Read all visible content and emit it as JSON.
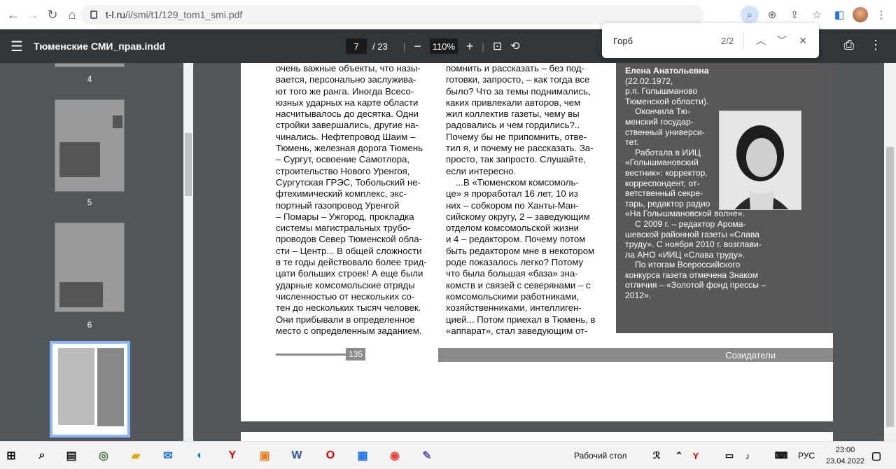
{
  "browser": {
    "url_host": "t-l.ru",
    "url_path": "/i/smi/t1/129_tom1_smi.pdf"
  },
  "pdf_toolbar": {
    "title": "Тюменские СМИ_прав.indd",
    "current_page": "7",
    "total_pages": "/ 23",
    "zoom": "110%"
  },
  "find": {
    "query": "Горб",
    "count": "2/2"
  },
  "thumbnails": [
    {
      "label": "4"
    },
    {
      "label": "5"
    },
    {
      "label": "6"
    }
  ],
  "article": {
    "col1": [
      "очень важные объекты, что назы-",
      "вается, персонально заслужива-",
      "ют того же ранга. Иногда Всесо-",
      "юзных ударных на карте области",
      "насчитывалось до десятка. Одни",
      "стройки завершались, другие на-",
      "чинались. Нефтепровод Шаим –",
      "Тюмень, железная дорога Тюмень",
      "– Сургут, освоение Самотлора,",
      "строительство Нового Уренгоя,",
      "Сургутская ГРЭС, Тобольский не-",
      "фтехимический комплекс, экс-",
      "портный газопровод Уренгой",
      "– Помары – Ужгород, прокладка",
      "системы магистральных трубо-",
      "проводов Север Тюменской обла-",
      "сти – Центр... В общей сложности",
      "в те годы действовало более трид-",
      "цати больших строек! А еще были",
      "ударные комсомольские отряды",
      "численностью от нескольких со-",
      "тен до нескольких тысяч человек.",
      "Они прибывали в определенное",
      "место с определенным заданием."
    ],
    "col2": [
      "помнить и рассказать – без под-",
      "готовки, запросто, – как тогда все",
      "было? Что за темы поднимались,",
      "каких привлекали авторов, чем",
      "жил коллектив газеты, чему вы",
      "радовались и чем гордились?..",
      "Почему бы не припомнить, отве-",
      "тил я, и почему не рассказать. За-",
      "просто, так запросто. Слушайте,",
      "если интересно.",
      "...В «Тюменском комсомоль-",
      "це» я проработал 16 лет, 10 из",
      "них – собкором по Ханты-Ман-",
      "сийскому округу, 2 – заведующим",
      "отделом комсомольской жизни",
      "и 4 – редактором. Почему потом",
      "быть редактором мне в некотором",
      "роде показалось легко? Потому",
      "что была большая «база» зна-",
      "комств и связей с северянами – с",
      "комсомольскими работниками,",
      "хозяйственниками, интеллиген-",
      "цией... Потом приехал в Тюмень, в",
      "«аппарат», стал заведующим от-"
    ],
    "bio": [
      "Елена Анатольевна",
      "(22.02.1972,",
      "р.п. Голышманово",
      "Тюменской области).",
      "Окончила Тю-",
      "менский государ-",
      "ственный универси-",
      "тет.",
      "Работала в ИИЦ",
      "«Голышмановский",
      "вестник»: корректор,",
      "корреспондент, от-",
      "ветственный секре-",
      "тарь, редактор радио",
      "«На Голышмановской волне».",
      "С 2009 г. – редактор Арома-",
      "шевской районной газеты «Слава",
      "труду». С ноября 2010 г. возглави-",
      "ла АНО «ИИЦ «Слава труду».",
      "По итогам Всероссийского",
      "конкурса газета отмечена Знаком",
      "отличия – «Золотой фонд прессы –",
      "2012»."
    ],
    "page_number": "135",
    "section": "Созидатели"
  },
  "taskbar": {
    "desktop_label": "Рабочий стол",
    "lang": "РУС",
    "time": "23:00",
    "date": "23.04.2022"
  },
  "colors": {
    "toolbar": "#323639",
    "viewer_bg": "#525659",
    "bio_bg": "#58585a"
  }
}
